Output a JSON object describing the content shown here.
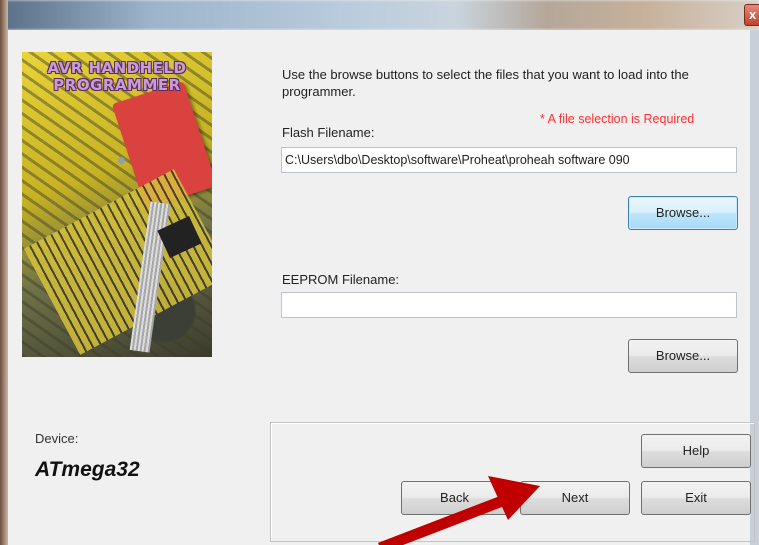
{
  "window": {
    "close_glyph": "x"
  },
  "image": {
    "logo_line1": "AVR HANDHELD",
    "logo_line2": "PROGRAMMER"
  },
  "instructions": "Use the browse buttons to select the files that you want to load into the programmer.",
  "required_note": "* A file selection is Required",
  "flash": {
    "label": "Flash Filename:",
    "value": "C:\\Users\\dbo\\Desktop\\software\\Proheat\\proheah software 090",
    "browse_label": "Browse..."
  },
  "eeprom": {
    "label": "EEPROM Filename:",
    "value": "",
    "browse_label": "Browse..."
  },
  "device": {
    "caption": "Device:",
    "name": "ATmega32"
  },
  "buttons": {
    "help": "Help",
    "back": "Back",
    "next": "Next",
    "exit": "Exit"
  },
  "colors": {
    "required_red": "#ff3030",
    "arrow_red": "#c00000",
    "focus_blue": "#3c7fb1"
  },
  "icons": {
    "close": "close-icon",
    "arrow": "annotation-arrow-icon"
  }
}
